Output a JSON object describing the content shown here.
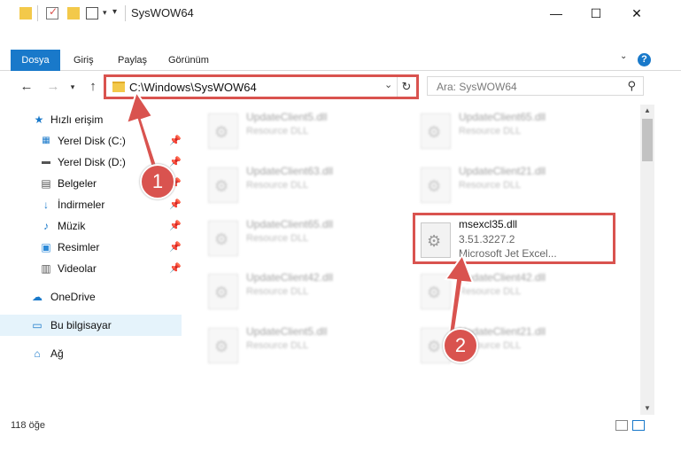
{
  "window": {
    "title": "SysWOW64",
    "minimize": "—",
    "maximize": "☐",
    "close": "✕"
  },
  "ribbon": {
    "tabs": [
      "Dosya",
      "Giriş",
      "Paylaş",
      "Görünüm"
    ],
    "help": "?"
  },
  "address_bar": {
    "path": "C:\\Windows\\SysWOW64",
    "search_placeholder": "Ara: SysWOW64"
  },
  "sidebar": {
    "items": [
      {
        "label": "Hızlı erişim",
        "icon": "star-icon",
        "pinned": false
      },
      {
        "label": "Yerel Disk (C:)",
        "icon": "windows-drive-icon",
        "pinned": true
      },
      {
        "label": "Yerel Disk (D:)",
        "icon": "drive-icon",
        "pinned": true
      },
      {
        "label": "Belgeler",
        "icon": "documents-icon",
        "pinned": true
      },
      {
        "label": "İndirmeler",
        "icon": "download-icon",
        "pinned": true
      },
      {
        "label": "Müzik",
        "icon": "music-icon",
        "pinned": true
      },
      {
        "label": "Resimler",
        "icon": "pictures-icon",
        "pinned": true
      },
      {
        "label": "Videolar",
        "icon": "videos-icon",
        "pinned": true
      },
      {
        "label": "OneDrive",
        "icon": "cloud-icon",
        "pinned": false
      },
      {
        "label": "Bu bilgisayar",
        "icon": "computer-icon",
        "pinned": false,
        "selected": true
      },
      {
        "label": "Ağ",
        "icon": "network-icon",
        "pinned": false
      }
    ]
  },
  "files": {
    "left_column": [
      {
        "name": "UpdateClient5.dll",
        "desc": "Resource DLL"
      },
      {
        "name": "UpdateClient63.dll",
        "desc": "Resource DLL"
      },
      {
        "name": "UpdateClient65.dll",
        "desc": "Resource DLL"
      },
      {
        "name": "UpdateClient42.dll",
        "desc": "Resource DLL"
      },
      {
        "name": "UpdateClient5.dll",
        "desc": "Resource DLL"
      }
    ],
    "right_column": [
      {
        "name": "UpdateClient65.dll",
        "desc": "Resource DLL"
      },
      {
        "name": "UpdateClient21.dll",
        "desc": "Resource DLL"
      },
      {
        "name": "UpdateClient42.dll",
        "desc": "Resource DLL"
      },
      {
        "name": "UpdateClient21.dll",
        "desc": "Resource DLL"
      }
    ],
    "selected": {
      "name": "msexcl35.dll",
      "version": "3.51.3227.2",
      "desc": "Microsoft Jet Excel..."
    }
  },
  "status_bar": {
    "item_count": "118 öğe"
  },
  "annotations": {
    "step1": "1",
    "step2": "2",
    "color": "#d9534f"
  }
}
